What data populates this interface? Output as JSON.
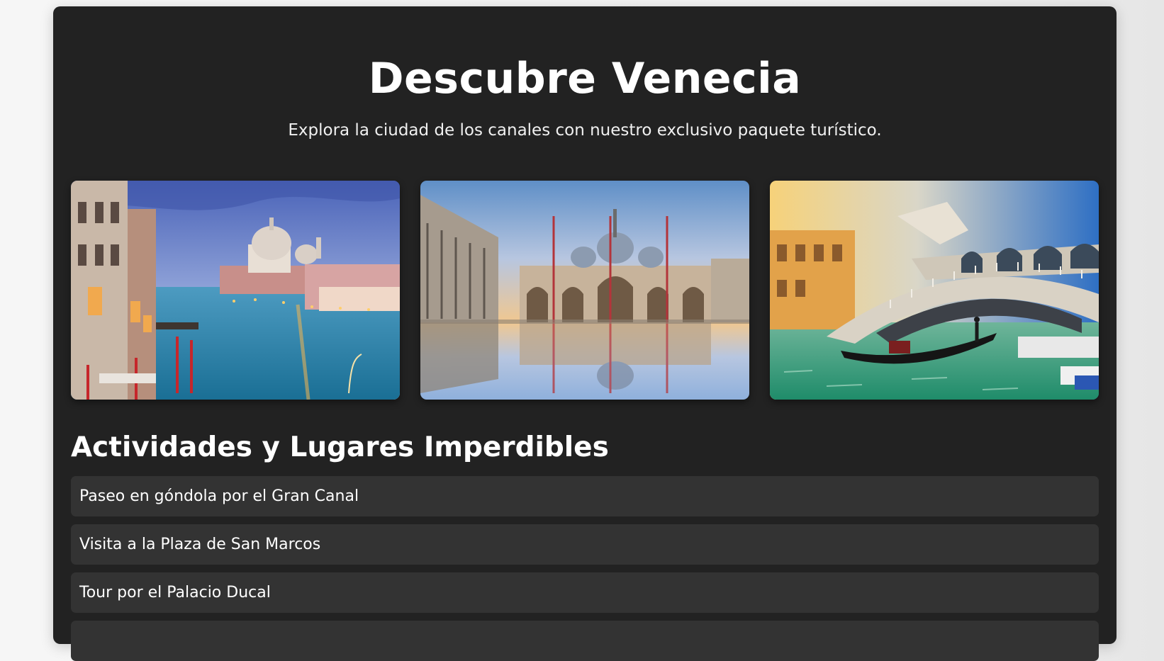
{
  "hero": {
    "title": "Descubre Venecia",
    "subtitle": "Explora la ciudad de los canales con nuestro exclusivo paquete turístico."
  },
  "gallery": [
    {
      "subject": "Gran Canal con la Basílica de Santa Maria della Salute al atardecer"
    },
    {
      "subject": "Basílica de San Marcos reflejada en la plaza inundada"
    },
    {
      "subject": "Puente de Rialto con góndola sobre el Gran Canal"
    }
  ],
  "activities": {
    "heading": "Actividades y Lugares Imperdibles",
    "items": [
      {
        "label": "Paseo en góndola por el Gran Canal"
      },
      {
        "label": "Visita a la Plaza de San Marcos"
      },
      {
        "label": "Tour por el Palacio Ducal"
      },
      {
        "label": ""
      }
    ]
  },
  "colors": {
    "page_background": "#f3f3f3",
    "card_background": "#222222",
    "list_item_background": "#333333",
    "text": "#ffffff"
  }
}
